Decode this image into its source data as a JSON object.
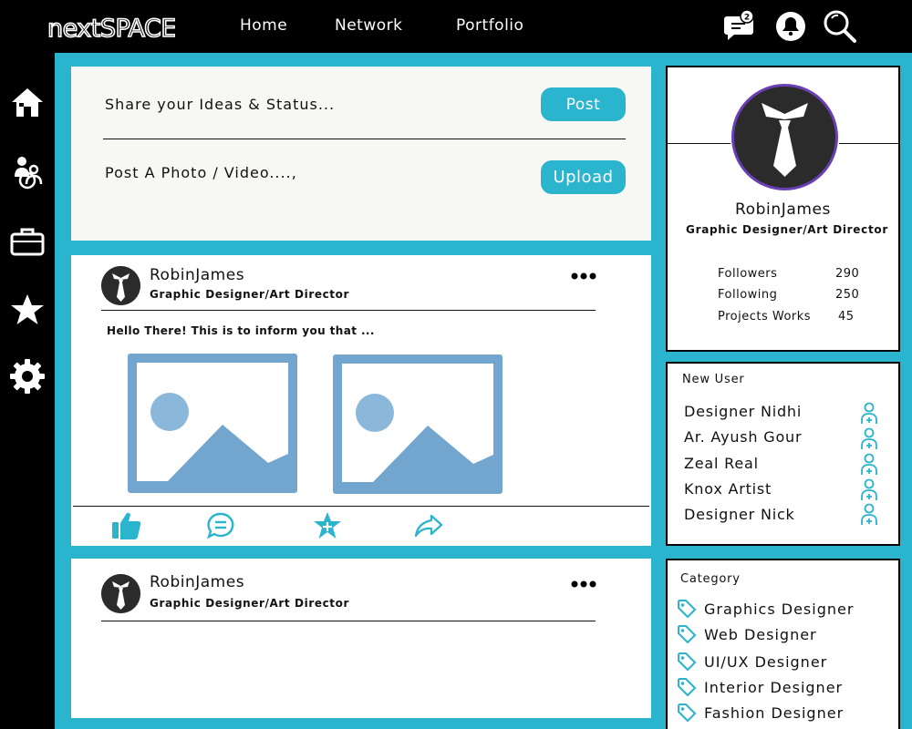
{
  "brand": {
    "logo_text": "nextSPACE",
    "accent": "#2ab4cd"
  },
  "nav": {
    "home": "Home",
    "network": "Network",
    "portfolio": "Portfolio"
  },
  "topbar": {
    "message_badge": "2",
    "icons": [
      "message-icon",
      "notification-bell-icon",
      "search-icon"
    ]
  },
  "sidebar": {
    "icons": [
      "home-icon",
      "network-users-icon",
      "portfolio-briefcase-icon",
      "favorites-star-icon",
      "settings-gear-icon"
    ]
  },
  "share": {
    "status_label": "Share your Ideas & Status...",
    "post_button": "Post",
    "photo_label": "Post A Photo / Video....,",
    "upload_button": "Upload"
  },
  "posts": [
    {
      "name": "RobinJames",
      "role": "Graphic Designer/Art Director",
      "text": "Hello There! This is to inform you that ...",
      "actions": [
        "like-icon",
        "comment-icon",
        "favorite-icon",
        "share-icon"
      ]
    },
    {
      "name": "RobinJames",
      "role": "Graphic Designer/Art Director"
    }
  ],
  "profile": {
    "name": "RobinJames",
    "role": "Graphic Designer/Art Director",
    "stats": [
      {
        "label": "Followers",
        "value": "290"
      },
      {
        "label": "Following",
        "value": "250"
      },
      {
        "label": "Projects Works",
        "value": "45"
      }
    ]
  },
  "new_users": {
    "title": "New User",
    "items": [
      "Designer Nidhi",
      "Ar. Ayush Gour",
      "Zeal Real",
      "Knox Artist",
      "Designer Nick"
    ]
  },
  "categories": {
    "title": "Category",
    "items": [
      "Graphics Designer",
      "Web Designer",
      "UI/UX Designer",
      "Interior Designer",
      "Fashion Designer"
    ]
  }
}
